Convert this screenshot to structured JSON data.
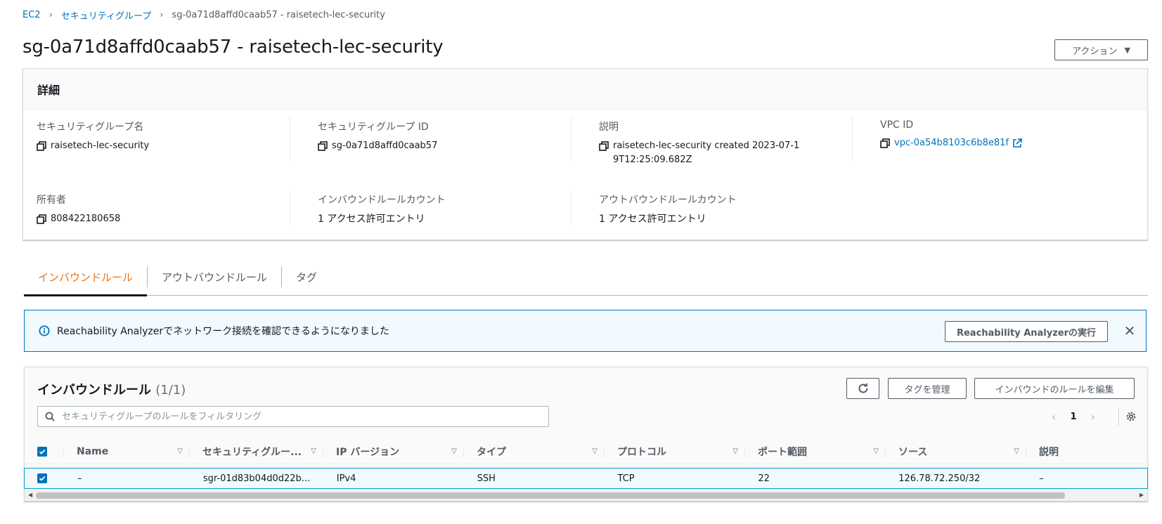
{
  "breadcrumb": {
    "items": [
      "EC2",
      "セキュリティグループ"
    ],
    "current": "sg-0a71d8affd0caab57 - raisetech-lec-security"
  },
  "page_title": "sg-0a71d8affd0caab57 - raisetech-lec-security",
  "actions_label": "アクション",
  "details": {
    "header": "詳細",
    "sg_name_label": "セキュリティグループ名",
    "sg_name_value": "raisetech-lec-security",
    "sg_id_label": "セキュリティグループ ID",
    "sg_id_value": "sg-0a71d8affd0caab57",
    "desc_label": "説明",
    "desc_value": "raisetech-lec-security created 2023-07-19T12:25:09.682Z",
    "vpc_label": "VPC ID",
    "vpc_value": "vpc-0a54b8103c6b8e81f",
    "owner_label": "所有者",
    "owner_value": "808422180658",
    "inbound_count_label": "インバウンドルールカウント",
    "inbound_count_value": "1 アクセス許可エントリ",
    "outbound_count_label": "アウトバウンドルールカウント",
    "outbound_count_value": "1 アクセス許可エントリ"
  },
  "tabs": [
    "インバウンドルール",
    "アウトバウンドルール",
    "タグ"
  ],
  "banner": {
    "message": "Reachability Analyzerでネットワーク接続を確認できるようになりました",
    "button": "Reachability Analyzerの実行"
  },
  "rules": {
    "title": "インバウンドルール",
    "count": "(1/1)",
    "manage_tags": "タグを管理",
    "edit_rules": "インバウンドのルールを編集",
    "search_placeholder": "セキュリティグループのルールをフィルタリング",
    "page": "1",
    "columns": [
      "Name",
      "セキュリティグルー...",
      "IP バージョン",
      "タイプ",
      "プロトコル",
      "ポート範囲",
      "ソース",
      "説明"
    ],
    "rows": [
      [
        "–",
        "sgr-01d83b04d0d22b...",
        "IPv4",
        "SSH",
        "TCP",
        "22",
        "126.78.72.250/32",
        "–"
      ]
    ]
  },
  "colors": {
    "link": "#0073bb",
    "active_tab": "#ec7211",
    "checkbox": "#0073bb",
    "banner_border": "#0073bb"
  }
}
